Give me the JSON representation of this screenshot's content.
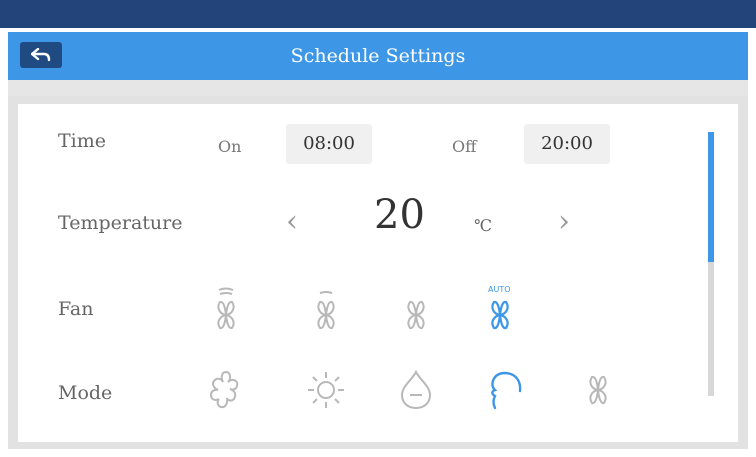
{
  "header": {
    "title": "Schedule Settings",
    "back_icon": "back-arrow-icon"
  },
  "time": {
    "label": "Time",
    "on_label": "On",
    "on_value": "08:00",
    "off_label": "Off",
    "off_value": "20:00"
  },
  "temperature": {
    "label": "Temperature",
    "value": "20",
    "unit": "℃",
    "decrease_glyph": "‹",
    "increase_glyph": "›"
  },
  "fan": {
    "label": "Fan",
    "options": [
      "fan-high-icon",
      "fan-medium-icon",
      "fan-low-icon",
      "fan-auto-icon"
    ],
    "selected": "fan-auto-icon",
    "auto_text": "AUTO"
  },
  "mode": {
    "label": "Mode",
    "options": [
      "cool-icon",
      "heat-icon",
      "dry-icon",
      "auto-mode-icon",
      "fan-only-icon"
    ],
    "selected": "auto-mode-icon"
  },
  "colors": {
    "accent": "#3d97e6",
    "header_band": "#22447a",
    "icon_inactive": "#b8b8b8"
  },
  "scroll": {
    "position_fraction": 0.0,
    "visible_fraction": 0.5
  }
}
